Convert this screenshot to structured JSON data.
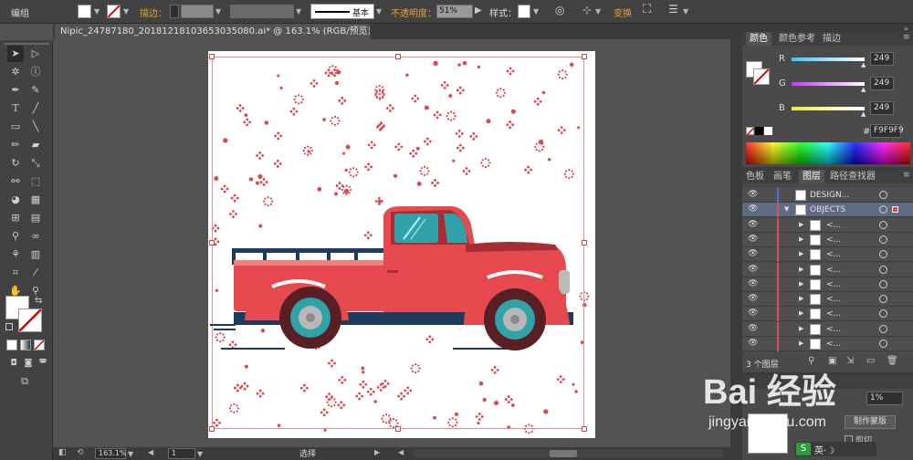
{
  "control_bar": {
    "group_label": "编组",
    "stroke_label": "描边：",
    "brush_label": "基本",
    "opacity_label": "不透明度：",
    "opacity_value": "51%",
    "style_label": "样式：",
    "transform_label": "变换"
  },
  "document": {
    "tab_title": "Nipic_24787180_20181218103653035080.ai* @ 163.1% (RGB/预览)"
  },
  "color_panel": {
    "tabs": [
      "颜色",
      "颜色参考",
      "描边"
    ],
    "channels": [
      {
        "name": "R",
        "value": "249",
        "color": "#ff3b3b"
      },
      {
        "name": "G",
        "value": "249",
        "color": "#b73ad6"
      },
      {
        "name": "B",
        "value": "249",
        "color": "#ecec2e"
      }
    ],
    "hex_label": "#",
    "hex_value": "F9F9F9"
  },
  "layers_panel": {
    "tabs": [
      "色板",
      "画笔",
      "图层",
      "路径查找器"
    ],
    "layers": [
      {
        "name": "DESIGN...",
        "color": "#4b6fe0"
      },
      {
        "name": "OBJECTS",
        "color": "#e05050"
      },
      {
        "name": "<..."
      },
      {
        "name": "<..."
      },
      {
        "name": "<..."
      },
      {
        "name": "<..."
      },
      {
        "name": "<..."
      },
      {
        "name": "<..."
      },
      {
        "name": "<..."
      },
      {
        "name": "<..."
      },
      {
        "name": "<..."
      }
    ],
    "count_label": "3 个图层"
  },
  "transparency_panel": {
    "opacity_value": "1%",
    "mask_button": "制作蒙版",
    "clip_label": "剪切"
  },
  "status_bar": {
    "zoom": "163.1%",
    "page": "1",
    "tool": "选择"
  },
  "watermark": {
    "logo_text": "Bai 经验",
    "url_text": "jingyan.baidu.com"
  },
  "colors": {
    "truck_red": "#e64a4f",
    "truck_dark": "#a52d33",
    "navy": "#1e3a5c",
    "teal": "#2fa3a8",
    "snow_red": "#e0454f"
  }
}
